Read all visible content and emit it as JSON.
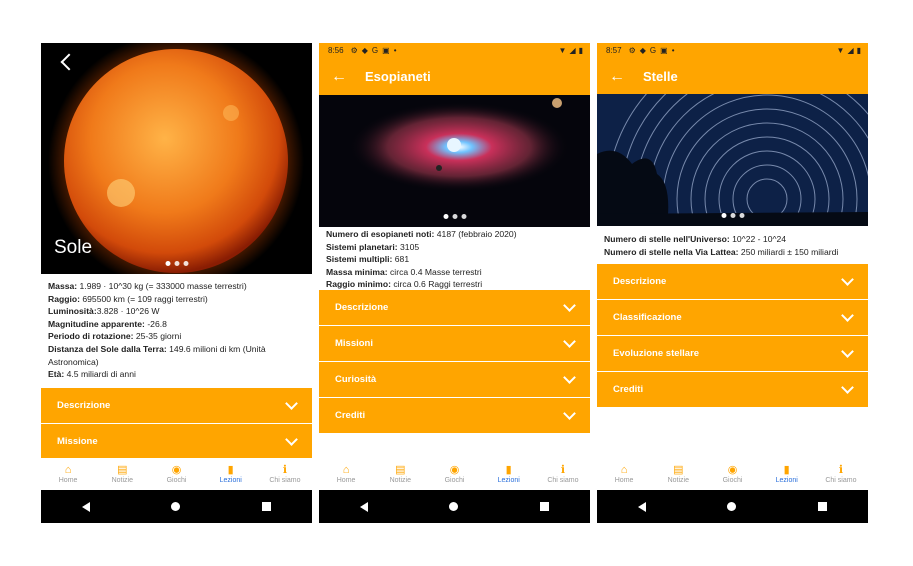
{
  "screens": [
    {
      "title": "Sole",
      "status": null,
      "info": [
        {
          "label": "Massa:",
          "value": " 1.989 · 10^30 kg (= 333000 masse terrestri)"
        },
        {
          "label": "Raggio:",
          "value": " 695500 km (= 109 raggi terrestri)"
        },
        {
          "label": "Luminosità:",
          "value": "3.828 · 10^26 W"
        },
        {
          "label": "Magnitudine apparente:",
          "value": " -26.8"
        },
        {
          "label": "Periodo di rotazione:",
          "value": " 25-35 giorni"
        },
        {
          "label": "Distanza del Sole dalla Terra:",
          "value": " 149.6 milioni di km (Unità Astronomica)"
        },
        {
          "label": "Età:",
          "value": " 4.5 miliardi di anni"
        }
      ],
      "sections": [
        "Descrizione",
        "Missione"
      ]
    },
    {
      "title": "Esopianeti",
      "status": {
        "time": "8:56"
      },
      "info": [
        {
          "label": "Numero di esopianeti noti:",
          "value": " 4187 (febbraio 2020)"
        },
        {
          "label": "Sistemi planetari:",
          "value": " 3105"
        },
        {
          "label": "Sistemi multipli:",
          "value": " 681"
        },
        {
          "label": "Massa minima:",
          "value": " circa 0.4 Masse terrestri"
        },
        {
          "label": "Raggio minimo:",
          "value": " circa 0.6 Raggi terrestri"
        }
      ],
      "sections": [
        "Descrizione",
        "Missioni",
        "Curiosità",
        "Crediti"
      ]
    },
    {
      "title": "Stelle",
      "status": {
        "time": "8:57"
      },
      "info": [
        {
          "label": "Numero di stelle nell'Universo:",
          "value": " 10^22 - 10^24"
        },
        {
          "label": "Numero di stelle nella Via Lattea:",
          "value": " 250 miliardi ± 150 miliardi"
        }
      ],
      "sections": [
        "Descrizione",
        "Classificazione",
        "Evoluzione stellare",
        "Crediti"
      ]
    }
  ],
  "tabs": [
    {
      "label": "Home",
      "icon": "home-icon",
      "glyph": "⌂"
    },
    {
      "label": "Notizie",
      "icon": "news-icon",
      "glyph": "▤"
    },
    {
      "label": "Giochi",
      "icon": "gamepad-icon",
      "glyph": "◉"
    },
    {
      "label": "Lezioni",
      "icon": "book-icon",
      "glyph": "▮"
    },
    {
      "label": "Chi siamo",
      "icon": "info-icon",
      "glyph": "ℹ"
    }
  ],
  "active_tab": "Lezioni",
  "colors": {
    "accent": "#ffa500",
    "active_tab": "#2a6fdb",
    "navbar": "#000000"
  }
}
